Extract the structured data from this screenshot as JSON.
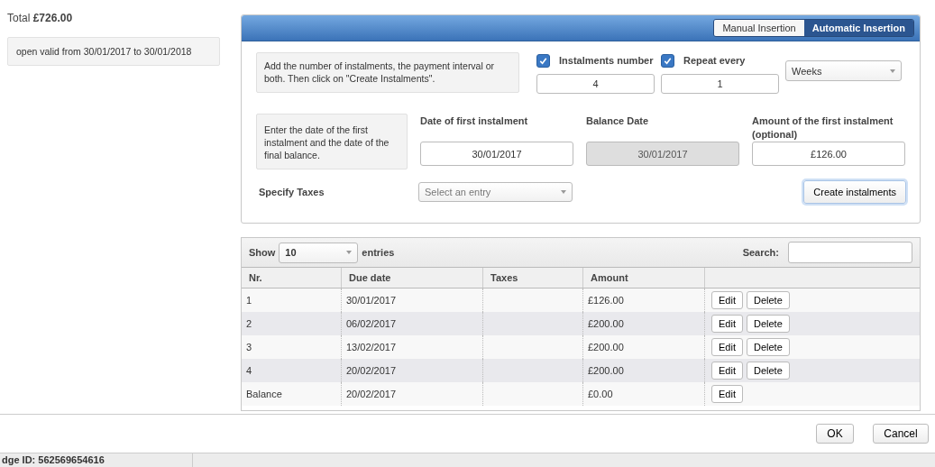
{
  "summary": {
    "total_label": "Total",
    "total_value": "£726.00",
    "validity": "open valid from 30/01/2017 to 30/01/2018"
  },
  "mode_tabs": [
    {
      "label": "Manual Insertion",
      "selected": false
    },
    {
      "label": "Automatic Insertion",
      "selected": true
    }
  ],
  "interval_hint": "Add the number of instalments, the payment interval or both. Then click on \"Create Instalments\".",
  "interval_fields": [
    {
      "label": "Instalments number",
      "checked": true,
      "value": "4"
    },
    {
      "label": "Repeat every",
      "checked": true,
      "value": "1"
    }
  ],
  "interval_unit": "Weeks",
  "date_hint": "Enter the date of the first instalment and the date of the final balance.",
  "date_fields": [
    {
      "label": "Date of first instalment",
      "value": "30/01/2017",
      "disabled": false
    },
    {
      "label": "Balance Date",
      "value": "30/01/2017",
      "disabled": true
    },
    {
      "label": "Amount of the first instalment (optional)",
      "value": "£126.00",
      "disabled": false
    }
  ],
  "taxes": {
    "label": "Specify Taxes",
    "placeholder": "Select an entry"
  },
  "create_button": "Create instalments",
  "table": {
    "show_label": "Show",
    "page_size": "10",
    "entries_label": "entries",
    "search_label": "Search:",
    "columns": [
      "Nr.",
      "Due date",
      "Taxes",
      "Amount"
    ],
    "rows": [
      {
        "cells": [
          "1",
          "30/01/2017",
          "",
          "£126.00"
        ],
        "actions": [
          "Edit",
          "Delete"
        ]
      },
      {
        "cells": [
          "2",
          "06/02/2017",
          "",
          "£200.00"
        ],
        "actions": [
          "Edit",
          "Delete"
        ]
      },
      {
        "cells": [
          "3",
          "13/02/2017",
          "",
          "£200.00"
        ],
        "actions": [
          "Edit",
          "Delete"
        ]
      },
      {
        "cells": [
          "4",
          "20/02/2017",
          "",
          "£200.00"
        ],
        "actions": [
          "Edit",
          "Delete"
        ]
      },
      {
        "cells": [
          "Balance",
          "20/02/2017",
          "",
          "£0.00"
        ],
        "actions": [
          "Edit"
        ]
      }
    ]
  },
  "footer_buttons": [
    "OK",
    "Cancel"
  ],
  "status_bar": "dge ID: 562569654616"
}
